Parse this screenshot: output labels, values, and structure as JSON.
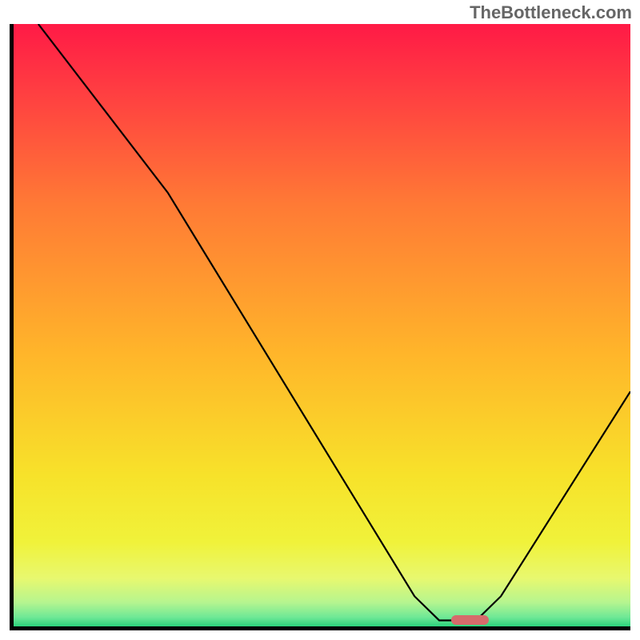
{
  "watermark": "TheBottleneck.com",
  "chart_data": {
    "type": "line",
    "title": "",
    "xlabel": "",
    "ylabel": "",
    "xlim": [
      0,
      100
    ],
    "ylim": [
      0,
      100
    ],
    "grid": false,
    "gradient_stops": [
      {
        "pct": 0.0,
        "color": "#ff1a46"
      },
      {
        "pct": 0.1,
        "color": "#ff3a42"
      },
      {
        "pct": 0.3,
        "color": "#ff7a35"
      },
      {
        "pct": 0.55,
        "color": "#ffb62a"
      },
      {
        "pct": 0.75,
        "color": "#f7e22a"
      },
      {
        "pct": 0.86,
        "color": "#f0f23a"
      },
      {
        "pct": 0.92,
        "color": "#e8f86f"
      },
      {
        "pct": 0.96,
        "color": "#b6f58f"
      },
      {
        "pct": 0.985,
        "color": "#6ee896"
      },
      {
        "pct": 1.0,
        "color": "#2bd37c"
      }
    ],
    "curve": [
      {
        "x": 4,
        "y": 100
      },
      {
        "x": 25,
        "y": 72
      },
      {
        "x": 65,
        "y": 5
      },
      {
        "x": 69,
        "y": 1
      },
      {
        "x": 75,
        "y": 1
      },
      {
        "x": 79,
        "y": 5
      },
      {
        "x": 100,
        "y": 39
      }
    ],
    "minimum_marker": {
      "x_start": 71,
      "x_end": 77,
      "y": 1.0
    }
  }
}
